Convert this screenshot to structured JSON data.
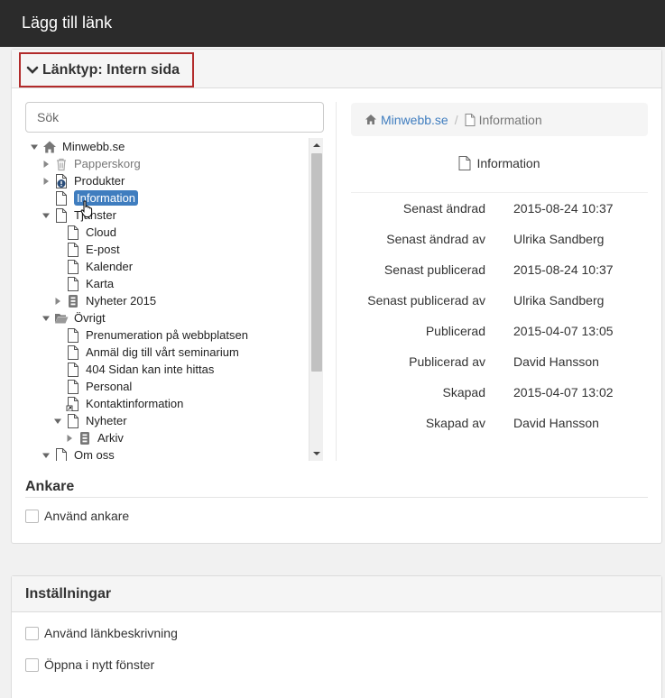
{
  "window": {
    "title": "Lägg till länk"
  },
  "link_type": {
    "label": "Länktyp: Intern sida"
  },
  "search": {
    "placeholder": "Sök"
  },
  "tree": [
    {
      "label": "Minwebb.se",
      "icon": "home-icon",
      "toggle": "expanded",
      "level": 0
    },
    {
      "label": "Papperskorg",
      "icon": "trash-icon",
      "toggle": "collapsed",
      "level": 1,
      "muted": true
    },
    {
      "label": "Produkter",
      "icon": "page-alert-icon",
      "toggle": "collapsed",
      "level": 1
    },
    {
      "label": "Information",
      "icon": "page-icon",
      "toggle": "none",
      "level": 1,
      "selected": true
    },
    {
      "label": "Tjänster",
      "icon": "page-icon",
      "toggle": "expanded",
      "level": 1
    },
    {
      "label": "Cloud",
      "icon": "page-icon",
      "toggle": "none",
      "level": 2
    },
    {
      "label": "E-post",
      "icon": "page-icon",
      "toggle": "none",
      "level": 2
    },
    {
      "label": "Kalender",
      "icon": "page-icon",
      "toggle": "none",
      "level": 2
    },
    {
      "label": "Karta",
      "icon": "page-icon",
      "toggle": "none",
      "level": 2
    },
    {
      "label": "Nyheter 2015",
      "icon": "archive-icon",
      "toggle": "collapsed",
      "level": 2
    },
    {
      "label": "Övrigt",
      "icon": "folder-open-icon",
      "toggle": "expanded",
      "level": 1
    },
    {
      "label": "Prenumeration på webbplatsen",
      "icon": "page-icon",
      "toggle": "none",
      "level": 2
    },
    {
      "label": "Anmäl dig till vårt seminarium",
      "icon": "page-icon",
      "toggle": "none",
      "level": 2
    },
    {
      "label": "404 Sidan kan inte hittas",
      "icon": "page-icon",
      "toggle": "none",
      "level": 2
    },
    {
      "label": "Personal",
      "icon": "page-icon",
      "toggle": "none",
      "level": 2
    },
    {
      "label": "Kontaktinformation",
      "icon": "page-link-icon",
      "toggle": "none",
      "level": 2
    },
    {
      "label": "Nyheter",
      "icon": "page-icon",
      "toggle": "expanded",
      "level": 2
    },
    {
      "label": "Arkiv",
      "icon": "archive-icon",
      "toggle": "collapsed",
      "level": 3
    },
    {
      "label": "Om oss",
      "icon": "page-icon",
      "toggle": "expanded",
      "level": 1
    }
  ],
  "breadcrumb": {
    "root": "Minwebb.se",
    "current": "Information"
  },
  "page_title": "Information",
  "properties": [
    {
      "key": "Senast ändrad",
      "value": "2015-08-24 10:37"
    },
    {
      "key": "Senast ändrad av",
      "value": "Ulrika Sandberg"
    },
    {
      "key": "Senast publicerad",
      "value": "2015-08-24 10:37"
    },
    {
      "key": "Senast publicerad av",
      "value": "Ulrika Sandberg"
    },
    {
      "key": "Publicerad",
      "value": "2015-04-07 13:05"
    },
    {
      "key": "Publicerad av",
      "value": "David Hansson"
    },
    {
      "key": "Skapad",
      "value": "2015-04-07 13:02"
    },
    {
      "key": "Skapad av",
      "value": "David Hansson"
    }
  ],
  "anchor": {
    "title": "Ankare",
    "use_anchor": "Använd ankare"
  },
  "settings": {
    "title": "Inställningar",
    "use_description": "Använd länkbeskrivning",
    "open_new_window": "Öppna i nytt fönster"
  },
  "colors": {
    "accent": "#3f7dbf",
    "highlight_border": "#b22b2b",
    "titlebar": "#2b2b2b"
  }
}
